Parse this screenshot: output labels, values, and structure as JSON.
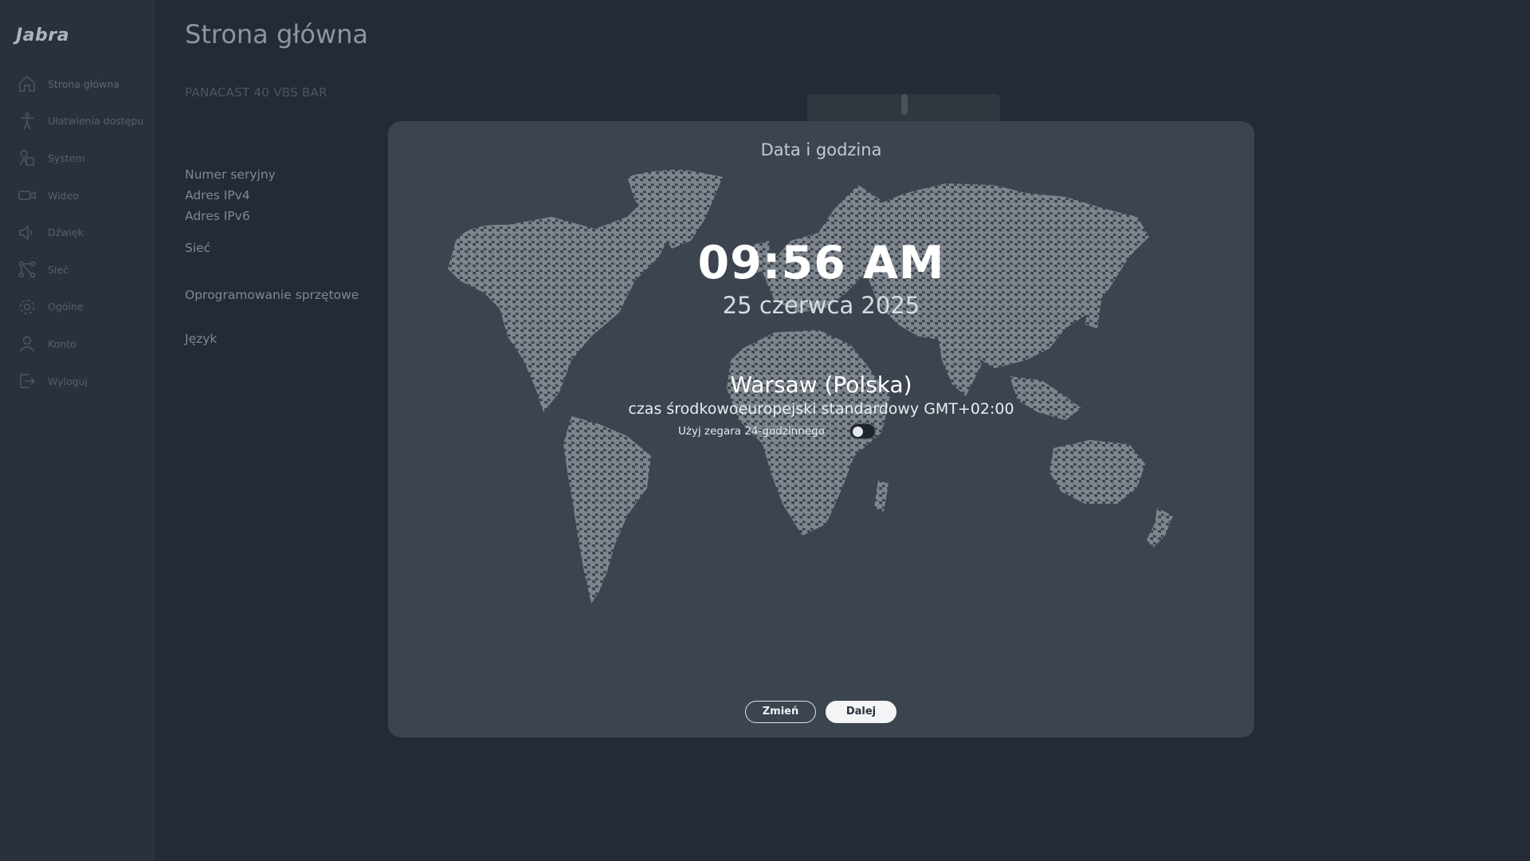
{
  "app": {
    "logo": "Jabra"
  },
  "sidebar": {
    "items": [
      {
        "label": "Strona główna",
        "icon": "home-icon",
        "active": true
      },
      {
        "label": "Ułatwienia dostępu",
        "icon": "accessibility-icon"
      },
      {
        "label": "System",
        "icon": "system-icon"
      },
      {
        "label": "Wideo",
        "icon": "video-icon"
      },
      {
        "label": "Dźwięk",
        "icon": "speaker-icon"
      },
      {
        "label": "Sieć",
        "icon": "network-icon"
      },
      {
        "label": "Ogólne",
        "icon": "gear-icon"
      },
      {
        "label": "Konto",
        "icon": "user-icon"
      },
      {
        "label": "Wyloguj",
        "icon": "logout-icon"
      }
    ]
  },
  "page": {
    "title": "Strona główna",
    "device_name": "PANACAST 40 VBS BAR",
    "info_labels": [
      "Numer seryjny",
      "Adres IPv4",
      "Adres IPv6",
      "Sieć",
      "Oprogramowanie sprzętowe",
      "Język"
    ]
  },
  "modal": {
    "title": "Data i godzina",
    "time": "09:56 AM",
    "date": "25 czerwca 2025",
    "location": "Warsaw (Polska)",
    "timezone": "czas środkowoeuropejski standardowy GMT+02:00",
    "toggle_label": "Użyj zegara 24-godzinnego",
    "toggle_on": false,
    "change_button": "Zmień",
    "next_button": "Dalej"
  },
  "colors": {
    "background": "#242b37",
    "sidebar": "#2a313d",
    "modal": "#3b444f",
    "map_dots": "#8a9097",
    "primary_button": "#f2f4f6"
  }
}
